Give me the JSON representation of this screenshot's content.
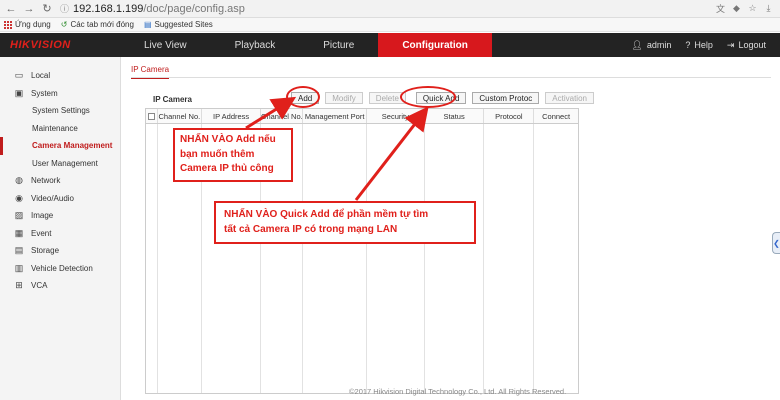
{
  "browser": {
    "url_host": "192.168.1.199",
    "url_path": "/doc/page/config.asp",
    "bookmarks": [
      "Ứng dụng",
      "Các tab mới đóng",
      "Suggested Sites"
    ]
  },
  "header": {
    "logo": "HIKVISION",
    "tabs": [
      {
        "label": "Live View"
      },
      {
        "label": "Playback"
      },
      {
        "label": "Picture"
      },
      {
        "label": "Configuration",
        "active": true
      }
    ],
    "user": "admin",
    "help": "Help",
    "logout": "Logout"
  },
  "sidebar": {
    "items": [
      {
        "label": "Local",
        "icon": "monitor-icon",
        "level": 0
      },
      {
        "label": "System",
        "icon": "system-icon",
        "level": 0
      },
      {
        "label": "System Settings",
        "level": 1
      },
      {
        "label": "Maintenance",
        "level": 1
      },
      {
        "label": "Camera Management",
        "level": 1,
        "active": true
      },
      {
        "label": "User Management",
        "level": 1
      },
      {
        "label": "Network",
        "icon": "globe-icon",
        "level": 0
      },
      {
        "label": "Video/Audio",
        "icon": "video-icon",
        "level": 0
      },
      {
        "label": "Image",
        "icon": "image-icon",
        "level": 0
      },
      {
        "label": "Event",
        "icon": "calendar-icon",
        "level": 0
      },
      {
        "label": "Storage",
        "icon": "storage-icon",
        "level": 0
      },
      {
        "label": "Vehicle Detection",
        "icon": "car-icon",
        "level": 0
      },
      {
        "label": "VCA",
        "icon": "vca-icon",
        "level": 0
      }
    ]
  },
  "main": {
    "subtab": "IP Camera",
    "section_title": "IP Camera",
    "buttons": [
      {
        "label": "Add",
        "disabled": false
      },
      {
        "label": "Modify",
        "disabled": true
      },
      {
        "label": "Delete",
        "disabled": true
      },
      {
        "label": "Quick Add",
        "disabled": false
      },
      {
        "label": "Custom Protoc",
        "disabled": false
      },
      {
        "label": "Activation",
        "disabled": true
      }
    ],
    "columns": [
      "Channel No.",
      "IP Address",
      "Channel No.",
      "Management Port",
      "Security",
      "Status",
      "Protocol",
      "Connect"
    ]
  },
  "annotations": {
    "add_note": [
      "NHẤN VÀO Add nếu",
      "bạn muốn thêm",
      "Camera IP thủ công"
    ],
    "quickadd_note": [
      "NHẤN VÀO Quick Add để phần mềm tự tìm",
      "tất cả Camera IP có trong mạng LAN"
    ]
  },
  "footer": "©2017 Hikvision Digital Technology Co., Ltd. All Rights Reserved.",
  "colors": {
    "accent": "#d7181d",
    "header_bg": "#232323",
    "annotation": "#e0201b"
  }
}
